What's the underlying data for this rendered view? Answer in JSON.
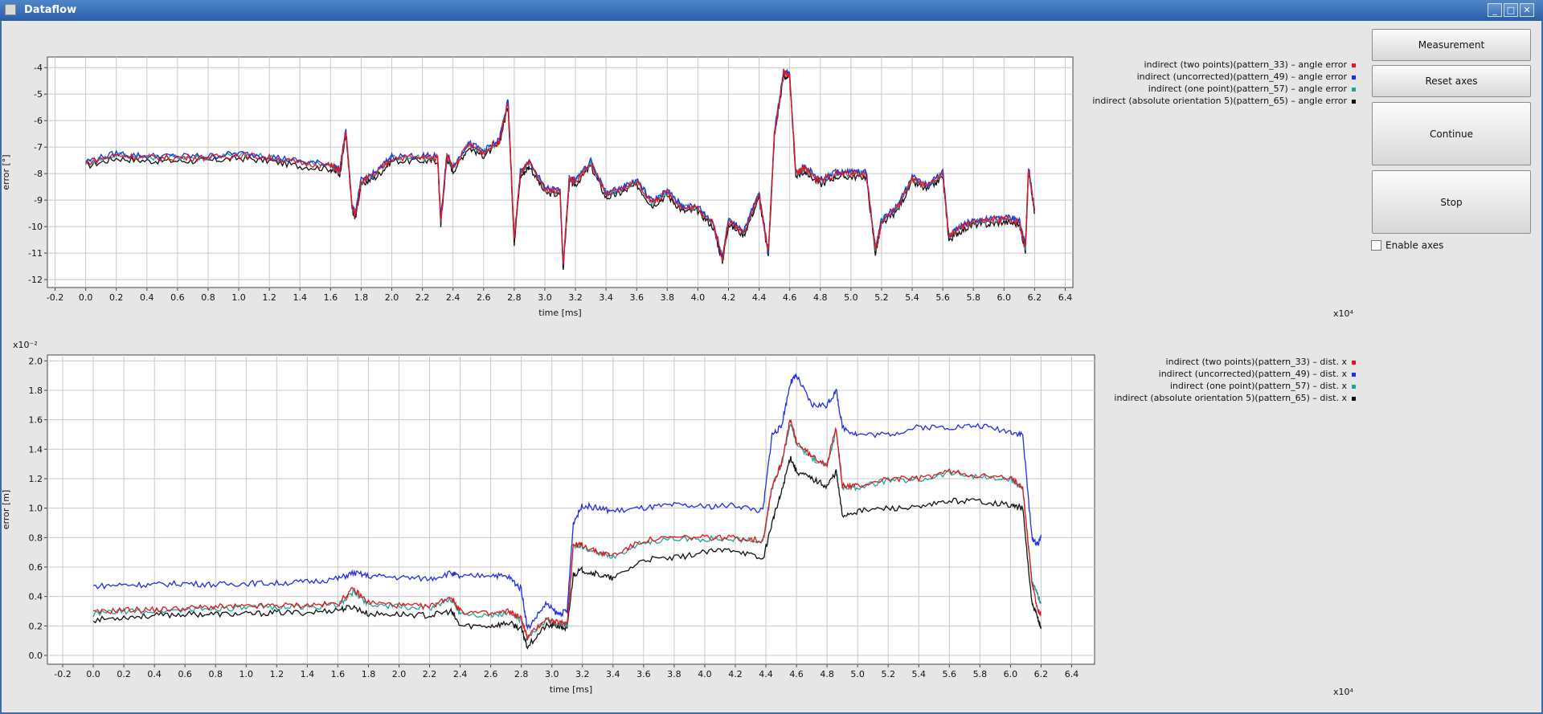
{
  "window": {
    "title": "Dataflow",
    "controls": [
      "_",
      "□",
      "✕"
    ]
  },
  "buttons": {
    "measurement": "Measurement",
    "reset_axes": "Reset axes",
    "continue": "Continue",
    "stop": "Stop"
  },
  "checkbox": {
    "enable_axes": "Enable axes",
    "checked": false
  },
  "colors": {
    "two_points": "#e8161a",
    "uncorrected": "#1f2ee8",
    "one_point": "#16a8a0",
    "absolute_orientation": "#111111"
  },
  "chart_data": [
    {
      "type": "line",
      "xlabel": "time [ms]",
      "ylabel": "error [°]",
      "x_multiplier": "x10⁴",
      "xlim": [
        -0.25,
        6.45
      ],
      "ylim": [
        -12.3,
        -3.6
      ],
      "xticks": [
        -0.2,
        0.0,
        0.2,
        0.4,
        0.6,
        0.8,
        1.0,
        1.2,
        1.4,
        1.6,
        1.8,
        2.0,
        2.2,
        2.4,
        2.6,
        2.8,
        3.0,
        3.2,
        3.4,
        3.6,
        3.8,
        4.0,
        4.2,
        4.4,
        4.6,
        4.8,
        5.0,
        5.2,
        5.4,
        5.6,
        5.8,
        6.0,
        6.2,
        6.4
      ],
      "yticks": [
        -4,
        -5,
        -6,
        -7,
        -8,
        -9,
        -10,
        -11,
        -12
      ],
      "grid": true,
      "legend_position": "top-right outside",
      "series": [
        {
          "name": "indirect (two points)(pattern_33) – angle error",
          "color": "#e8161a",
          "role": "two_points"
        },
        {
          "name": "indirect (uncorrected)(pattern_49) – angle error",
          "color": "#1f2ee8",
          "role": "uncorrected"
        },
        {
          "name": "indirect (one point)(pattern_57) – angle error",
          "color": "#16a8a0",
          "role": "one_point"
        },
        {
          "name": "indirect (absolute orientation 5)(pattern_65) – angle error",
          "color": "#111111",
          "role": "absolute_orientation"
        }
      ],
      "x": [
        0.0,
        0.2,
        0.4,
        0.6,
        0.8,
        1.0,
        1.2,
        1.4,
        1.6,
        1.66,
        1.7,
        1.74,
        1.76,
        1.8,
        1.9,
        2.0,
        2.2,
        2.3,
        2.32,
        2.36,
        2.4,
        2.5,
        2.6,
        2.7,
        2.76,
        2.8,
        2.84,
        2.9,
        3.0,
        3.1,
        3.12,
        3.16,
        3.2,
        3.3,
        3.4,
        3.5,
        3.6,
        3.7,
        3.8,
        3.9,
        4.0,
        4.1,
        4.16,
        4.2,
        4.3,
        4.4,
        4.46,
        4.5,
        4.56,
        4.6,
        4.64,
        4.7,
        4.8,
        4.9,
        5.0,
        5.1,
        5.16,
        5.2,
        5.3,
        5.4,
        5.5,
        5.6,
        5.64,
        5.7,
        5.8,
        5.9,
        6.0,
        6.1,
        6.14,
        6.16,
        6.2
      ],
      "y": [
        -7.6,
        -7.3,
        -7.4,
        -7.4,
        -7.4,
        -7.3,
        -7.4,
        -7.6,
        -7.7,
        -7.9,
        -6.4,
        -9.2,
        -9.6,
        -8.3,
        -8.0,
        -7.4,
        -7.4,
        -7.4,
        -9.8,
        -7.3,
        -7.8,
        -6.9,
        -7.2,
        -6.8,
        -5.3,
        -10.5,
        -8.0,
        -7.6,
        -8.6,
        -8.7,
        -11.5,
        -8.2,
        -8.3,
        -7.6,
        -8.8,
        -8.6,
        -8.3,
        -9.1,
        -8.7,
        -9.3,
        -9.3,
        -9.9,
        -11.2,
        -9.8,
        -10.2,
        -8.8,
        -11.0,
        -6.5,
        -4.2,
        -4.3,
        -8.0,
        -7.8,
        -8.3,
        -8.0,
        -8.0,
        -8.0,
        -10.9,
        -9.8,
        -9.3,
        -8.2,
        -8.5,
        -8.0,
        -10.4,
        -10.1,
        -9.8,
        -9.8,
        -9.7,
        -9.8,
        -10.8,
        -7.8,
        -9.4
      ]
    },
    {
      "type": "line",
      "xlabel": "time [ms]",
      "ylabel": "error [m]",
      "x_multiplier": "x10⁴",
      "y_multiplier": "x10⁻²",
      "xlim": [
        -0.3,
        6.55
      ],
      "ylim": [
        -0.06,
        2.04
      ],
      "xticks": [
        -0.2,
        0.0,
        0.2,
        0.4,
        0.6,
        0.8,
        1.0,
        1.2,
        1.4,
        1.6,
        1.8,
        2.0,
        2.2,
        2.4,
        2.6,
        2.8,
        3.0,
        3.2,
        3.4,
        3.6,
        3.8,
        4.0,
        4.2,
        4.4,
        4.6,
        4.8,
        5.0,
        5.2,
        5.4,
        5.6,
        5.8,
        6.0,
        6.2,
        6.4
      ],
      "yticks": [
        2.0,
        1.8,
        1.6,
        1.4,
        1.2,
        1.0,
        0.8,
        0.6,
        0.4,
        0.2,
        0.0
      ],
      "grid": true,
      "legend_position": "top-right outside",
      "series": [
        {
          "name": "indirect (two points)(pattern_33) – dist. x",
          "color": "#e8161a",
          "role": "two_points"
        },
        {
          "name": "indirect (uncorrected)(pattern_49) – dist. x",
          "color": "#1f2ee8",
          "role": "uncorrected"
        },
        {
          "name": "indirect (one point)(pattern_57) – dist. x",
          "color": "#16a8a0",
          "role": "one_point"
        },
        {
          "name": "indirect (absolute orientation 5)(pattern_65) – dist. x",
          "color": "#111111",
          "role": "absolute_orientation"
        }
      ],
      "x": [
        0.0,
        0.2,
        0.4,
        0.6,
        0.8,
        1.0,
        1.2,
        1.4,
        1.6,
        1.7,
        1.8,
        2.0,
        2.2,
        2.34,
        2.4,
        2.6,
        2.72,
        2.8,
        2.84,
        2.96,
        3.04,
        3.1,
        3.14,
        3.2,
        3.3,
        3.4,
        3.6,
        3.8,
        4.0,
        4.2,
        4.38,
        4.44,
        4.5,
        4.56,
        4.6,
        4.7,
        4.8,
        4.86,
        4.9,
        5.0,
        5.2,
        5.4,
        5.6,
        5.8,
        6.0,
        6.08,
        6.14,
        6.18,
        6.2
      ],
      "series_values": {
        "uncorrected": [
          0.47,
          0.48,
          0.48,
          0.49,
          0.48,
          0.49,
          0.49,
          0.5,
          0.52,
          0.56,
          0.54,
          0.53,
          0.52,
          0.56,
          0.53,
          0.55,
          0.53,
          0.45,
          0.18,
          0.35,
          0.28,
          0.3,
          0.9,
          1.02,
          1.0,
          0.98,
          1.0,
          1.02,
          1.01,
          1.02,
          0.98,
          1.5,
          1.55,
          1.85,
          1.9,
          1.7,
          1.7,
          1.8,
          1.55,
          1.5,
          1.5,
          1.55,
          1.55,
          1.56,
          1.52,
          1.5,
          0.8,
          0.75,
          0.82
        ],
        "two_points": [
          0.29,
          0.31,
          0.31,
          0.32,
          0.33,
          0.33,
          0.34,
          0.34,
          0.35,
          0.45,
          0.36,
          0.34,
          0.33,
          0.4,
          0.3,
          0.28,
          0.3,
          0.25,
          0.12,
          0.25,
          0.22,
          0.22,
          0.75,
          0.75,
          0.7,
          0.68,
          0.78,
          0.8,
          0.8,
          0.8,
          0.78,
          1.15,
          1.3,
          1.6,
          1.45,
          1.35,
          1.3,
          1.55,
          1.15,
          1.15,
          1.2,
          1.2,
          1.25,
          1.22,
          1.2,
          1.15,
          0.5,
          0.3,
          0.28
        ],
        "one_point": [
          0.28,
          0.3,
          0.3,
          0.31,
          0.32,
          0.32,
          0.33,
          0.33,
          0.34,
          0.43,
          0.35,
          0.33,
          0.32,
          0.38,
          0.29,
          0.27,
          0.29,
          0.24,
          0.11,
          0.24,
          0.21,
          0.21,
          0.74,
          0.74,
          0.69,
          0.67,
          0.77,
          0.79,
          0.79,
          0.79,
          0.77,
          1.14,
          1.29,
          1.58,
          1.44,
          1.34,
          1.29,
          1.53,
          1.14,
          1.14,
          1.19,
          1.19,
          1.24,
          1.21,
          1.19,
          1.14,
          0.5,
          0.4,
          0.35
        ],
        "absolute_orientation": [
          0.24,
          0.26,
          0.27,
          0.28,
          0.28,
          0.28,
          0.29,
          0.29,
          0.31,
          0.33,
          0.28,
          0.28,
          0.27,
          0.3,
          0.2,
          0.2,
          0.22,
          0.18,
          0.06,
          0.2,
          0.2,
          0.18,
          0.55,
          0.58,
          0.55,
          0.52,
          0.65,
          0.66,
          0.7,
          0.72,
          0.65,
          0.9,
          1.1,
          1.35,
          1.25,
          1.2,
          1.15,
          1.25,
          0.95,
          0.98,
          1.0,
          1.0,
          1.05,
          1.05,
          1.02,
          1.0,
          0.35,
          0.25,
          0.18
        ]
      }
    }
  ]
}
